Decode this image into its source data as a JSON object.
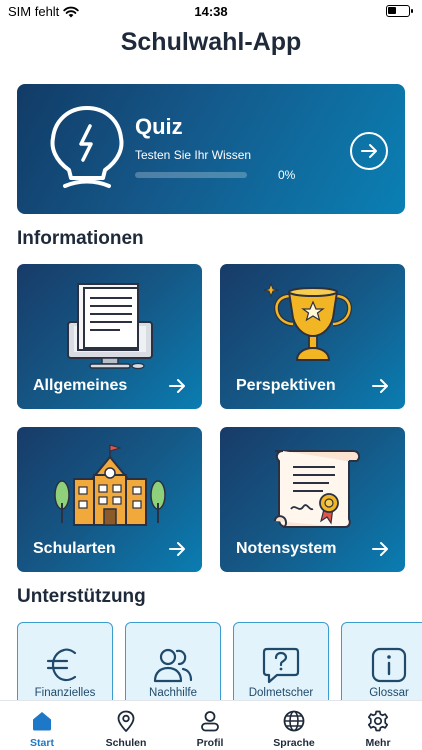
{
  "status_bar": {
    "carrier": "SIM fehlt",
    "time": "14:38"
  },
  "app": {
    "title": "Schulwahl-App"
  },
  "quiz": {
    "title": "Quiz",
    "subtitle": "Testen Sie Ihr Wissen",
    "progress_text": "0%",
    "progress_value": 0,
    "icon": "lightbulb-icon"
  },
  "sections": {
    "info_title": "Informationen",
    "support_title": "Unterstützung"
  },
  "info_tiles": [
    {
      "label": "Allgemeines",
      "icon": "document-monitor-icon"
    },
    {
      "label": "Perspektiven",
      "icon": "trophy-icon"
    },
    {
      "label": "Schularten",
      "icon": "school-building-icon"
    },
    {
      "label": "Notensystem",
      "icon": "certificate-icon"
    }
  ],
  "support": [
    {
      "label": "Finanzielles",
      "icon": "euro-icon"
    },
    {
      "label": "Nachhilfe",
      "icon": "people-icon"
    },
    {
      "label": "Dolmetscher",
      "icon": "question-bubble-icon"
    },
    {
      "label": "Glossar",
      "icon": "info-icon"
    }
  ],
  "tabs": [
    {
      "label": "Start",
      "icon": "home-icon",
      "active": true
    },
    {
      "label": "Schulen",
      "icon": "location-pin-icon"
    },
    {
      "label": "Profil",
      "icon": "person-icon"
    },
    {
      "label": "Sprache",
      "icon": "globe-icon"
    },
    {
      "label": "Mehr",
      "icon": "gear-icon"
    }
  ],
  "colors": {
    "accent": "#1e78c8",
    "card_dark": "#123b66",
    "card_light": "#0a80b4",
    "support_bg": "#e3f3fb",
    "support_border": "#3a9ccf"
  }
}
